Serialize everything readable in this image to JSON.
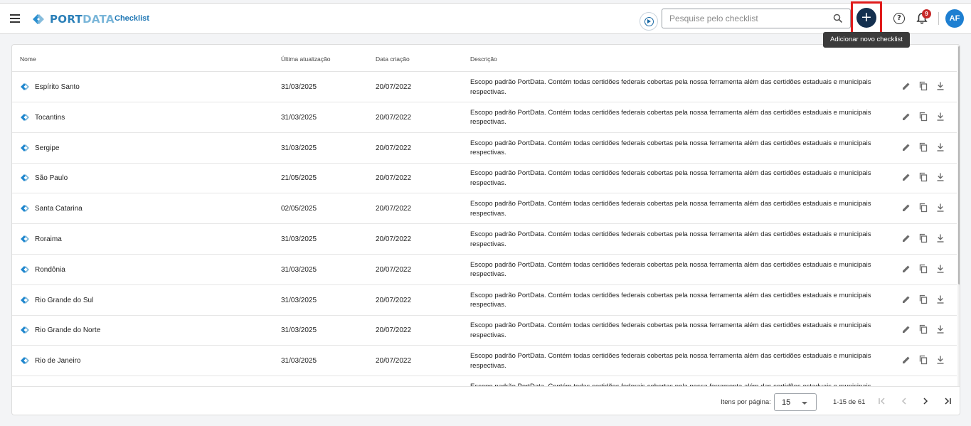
{
  "header": {
    "logo_port": "PORT",
    "logo_data": "DATA",
    "page": "Checklist",
    "search_placeholder": "Pesquise pelo checklist",
    "add_button": "+",
    "tooltip": "Adicionar novo checklist",
    "notification_count": "9",
    "avatar": "AF",
    "help": "?"
  },
  "colors": {
    "accent": "#1e76b4",
    "add_button": "#14304f",
    "highlight": "#e01b1b",
    "badge": "#c62828",
    "avatar": "#1e7fd1"
  },
  "table": {
    "columns": [
      "Nome",
      "Última atualização",
      "Data criação",
      "Descrição"
    ],
    "rows": [
      {
        "name": "Espírito Santo",
        "updated": "31/03/2025",
        "created": "20/07/2022",
        "description": "Escopo padrão PortData. Contém todas certidões federais cobertas pela nossa ferramenta além das certidões estaduais e municipais respectivas."
      },
      {
        "name": "Tocantins",
        "updated": "31/03/2025",
        "created": "20/07/2022",
        "description": "Escopo padrão PortData. Contém todas certidões federais cobertas pela nossa ferramenta além das certidões estaduais e municipais respectivas."
      },
      {
        "name": "Sergipe",
        "updated": "31/03/2025",
        "created": "20/07/2022",
        "description": "Escopo padrão PortData. Contém todas certidões federais cobertas pela nossa ferramenta além das certidões estaduais e municipais respectivas."
      },
      {
        "name": "São Paulo",
        "updated": "21/05/2025",
        "created": "20/07/2022",
        "description": "Escopo padrão PortData. Contém todas certidões federais cobertas pela nossa ferramenta além das certidões estaduais e municipais respectivas."
      },
      {
        "name": "Santa Catarina",
        "updated": "02/05/2025",
        "created": "20/07/2022",
        "description": "Escopo padrão PortData. Contém todas certidões federais cobertas pela nossa ferramenta além das certidões estaduais e municipais respectivas."
      },
      {
        "name": "Roraima",
        "updated": "31/03/2025",
        "created": "20/07/2022",
        "description": "Escopo padrão PortData. Contém todas certidões federais cobertas pela nossa ferramenta além das certidões estaduais e municipais respectivas."
      },
      {
        "name": "Rondônia",
        "updated": "31/03/2025",
        "created": "20/07/2022",
        "description": "Escopo padrão PortData. Contém todas certidões federais cobertas pela nossa ferramenta além das certidões estaduais e municipais respectivas."
      },
      {
        "name": "Rio Grande do Sul",
        "updated": "31/03/2025",
        "created": "20/07/2022",
        "description": "Escopo padrão PortData. Contém todas certidões federais cobertas pela nossa ferramenta além das certidões estaduais e municipais respectivas."
      },
      {
        "name": "Rio Grande do Norte",
        "updated": "31/03/2025",
        "created": "20/07/2022",
        "description": "Escopo padrão PortData. Contém todas certidões federais cobertas pela nossa ferramenta além das certidões estaduais e municipais respectivas."
      },
      {
        "name": "Rio de Janeiro",
        "updated": "31/03/2025",
        "created": "20/07/2022",
        "description": "Escopo padrão PortData. Contém todas certidões federais cobertas pela nossa ferramenta além das certidões estaduais e municipais respectivas."
      },
      {
        "name": "",
        "updated": "",
        "created": "",
        "description": "Escopo padrão PortData. Contém todas certidões federais cobertas pela nossa ferramenta além das certidões estaduais e municipais"
      }
    ],
    "row_icon": "portdata-logo-icon",
    "row_actions": [
      "edit-icon",
      "copy-icon",
      "download-icon"
    ]
  },
  "pagination": {
    "items_per_page_label": "Itens por página:",
    "items_per_page": "15",
    "range": "1-15 de 61"
  }
}
